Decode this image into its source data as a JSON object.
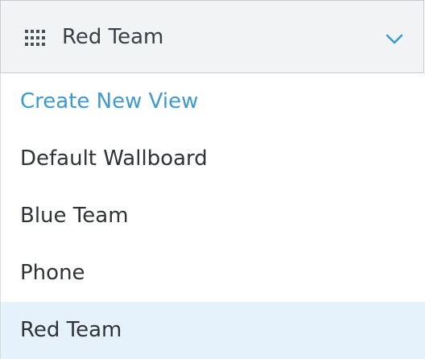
{
  "header": {
    "selected_label": "Red Team",
    "leading_icon": "grid-icon",
    "trailing_icon": "chevron-down-icon"
  },
  "menu": {
    "create_label": "Create New View",
    "items": [
      {
        "label": "Default Wallboard"
      },
      {
        "label": "Blue Team"
      },
      {
        "label": "Phone"
      },
      {
        "label": "Red Team",
        "selected": true
      }
    ]
  },
  "colors": {
    "accent": "#3d9ad1",
    "header_background": "#f1f3f4",
    "selected_background": "#e5f2fc",
    "text": "#2f3337"
  }
}
